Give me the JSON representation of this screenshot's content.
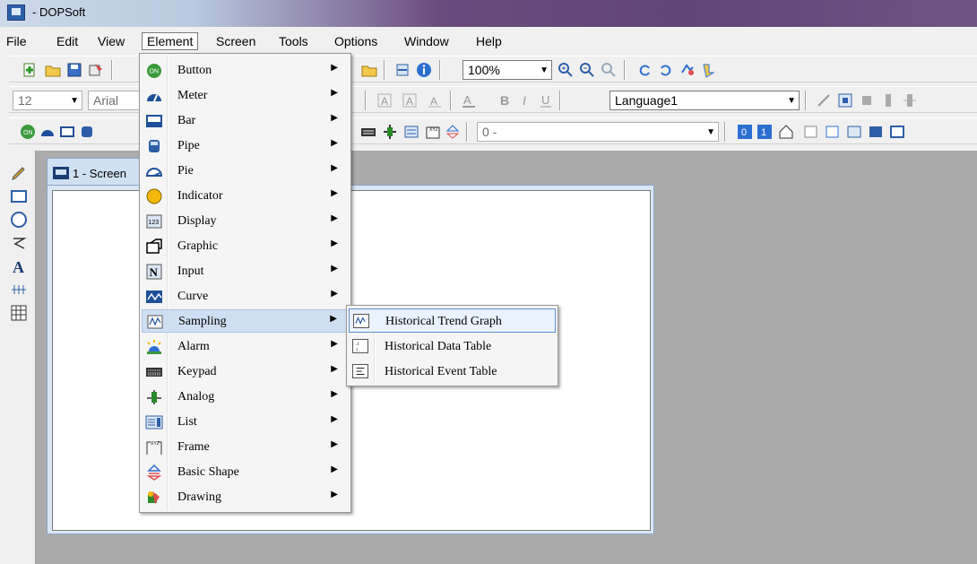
{
  "window": {
    "title": "- DOPSoft"
  },
  "menubar": {
    "items": [
      "File",
      "Edit",
      "View",
      "Element",
      "Screen",
      "Tools",
      "Options",
      "Window",
      "Help"
    ],
    "active": "Element"
  },
  "toolbar": {
    "zoom": "100%",
    "font_size": "12",
    "font_name": "Arial",
    "language": "Language1",
    "value_combo": "0 -"
  },
  "document_tab": {
    "label": "1 - Screen"
  },
  "element_menu": {
    "items": [
      {
        "label": "Button",
        "icon": "button-on-icon"
      },
      {
        "label": "Meter",
        "icon": "meter-icon"
      },
      {
        "label": "Bar",
        "icon": "bar-icon"
      },
      {
        "label": "Pipe",
        "icon": "pipe-icon"
      },
      {
        "label": "Pie",
        "icon": "pie-icon"
      },
      {
        "label": "Indicator",
        "icon": "indicator-icon"
      },
      {
        "label": "Display",
        "icon": "display-123-icon"
      },
      {
        "label": "Graphic",
        "icon": "graphic-icon"
      },
      {
        "label": "Input",
        "icon": "input-n-icon"
      },
      {
        "label": "Curve",
        "icon": "curve-icon"
      },
      {
        "label": "Sampling",
        "icon": "sampling-icon"
      },
      {
        "label": "Alarm",
        "icon": "alarm-icon"
      },
      {
        "label": "Keypad",
        "icon": "keypad-icon"
      },
      {
        "label": "Analog",
        "icon": "analog-icon"
      },
      {
        "label": "List",
        "icon": "list-icon"
      },
      {
        "label": "Frame",
        "icon": "frame-icon"
      },
      {
        "label": "Basic Shape",
        "icon": "basic-shape-icon"
      },
      {
        "label": "Drawing",
        "icon": "drawing-icon"
      }
    ],
    "highlighted": "Sampling"
  },
  "sampling_submenu": {
    "items": [
      {
        "label": "Historical Trend Graph",
        "icon": "trend-graph-icon"
      },
      {
        "label": "Historical Data Table",
        "icon": "data-table-icon"
      },
      {
        "label": "Historical Event Table",
        "icon": "event-table-icon"
      }
    ],
    "highlighted": "Historical Trend Graph"
  }
}
